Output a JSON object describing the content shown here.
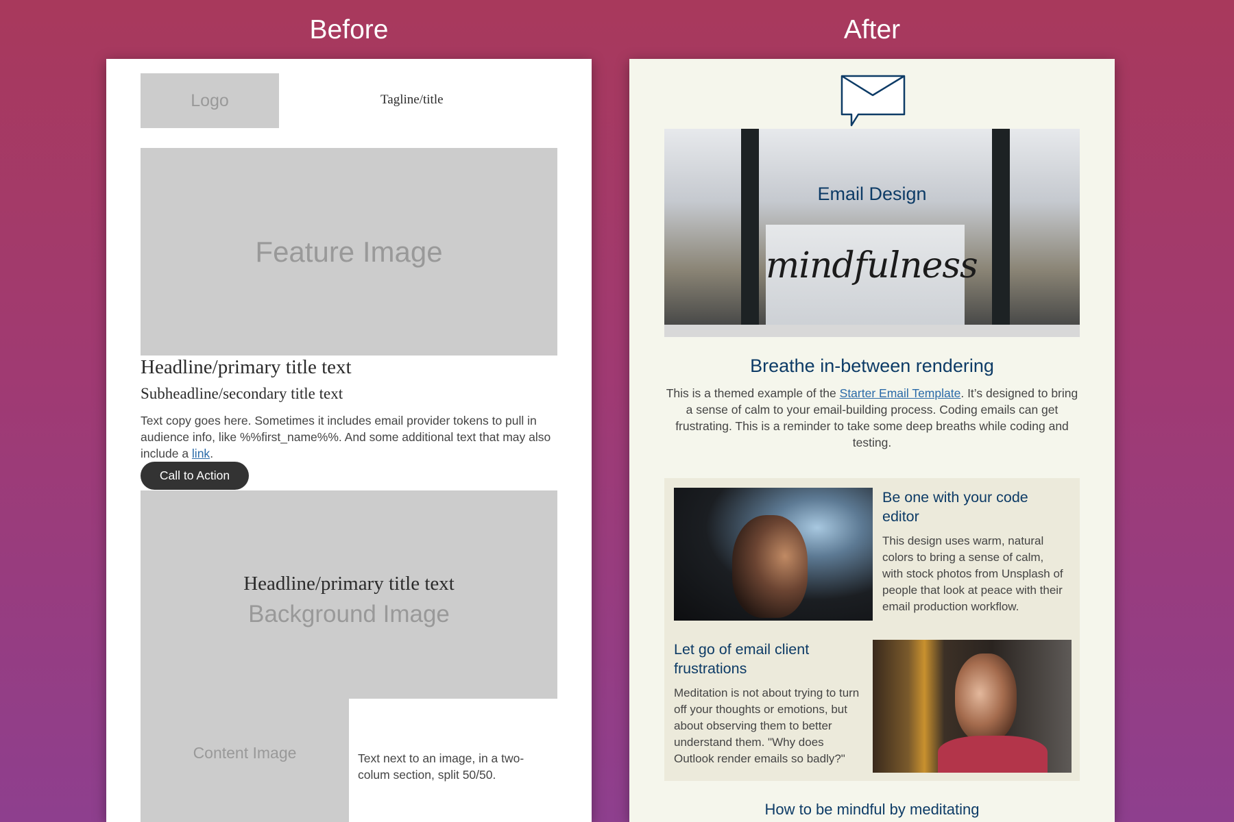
{
  "labels": {
    "before": "Before",
    "after": "After"
  },
  "before": {
    "logo": "Logo",
    "tagline": "Tagline/title",
    "feature_image": "Feature Image",
    "headline": "Headline/primary title text",
    "subheadline": "Subheadline/secondary title text",
    "copy_text": "Text copy goes here. Sometimes it includes email provider tokens to pull in audience info, like %%first_name%%. And some additional text that may also include a ",
    "copy_link": "link",
    "copy_end": ".",
    "cta": "Call to Action",
    "background_image": "Background Image",
    "bg_headline": "Headline/primary title text",
    "content_image": "Content Image",
    "twocol_text": "Text next to an image, in a two-colum section, split 50/50."
  },
  "after": {
    "icon": "envelope-speech-icon",
    "hero_title": "Email Design",
    "hero_script": "mindfulness",
    "title": "Breathe in-between rendering",
    "intro_before": "This is a themed example of the ",
    "intro_link": "Starter Email Template",
    "intro_after": ". It’s designed to bring a sense of calm to your email-building process. Coding emails can get frustrating. This is a reminder to take some deep breaths while coding and testing.",
    "section1": {
      "title": "Be one with your code editor",
      "body": "This design uses warm, natural colors to bring a sense of calm, with stock photos from Unsplash of people that look at peace with their email production workflow."
    },
    "section2": {
      "title": "Let go of email client frustrations",
      "body": "Meditation is not about trying to turn off your thoughts or emotions, but about observing them to better understand them. \"Why does Outlook render emails so badly?\""
    },
    "bottom_title": "How to be mindful by meditating"
  },
  "colors": {
    "background_top": "#a8395c",
    "background_bottom": "#8e3f8e",
    "placeholder": "#cccccc",
    "after_background": "#f5f6ec",
    "after_box": "#eceadb",
    "heading_blue": "#0d3b66",
    "link_blue": "#2a6aa8",
    "cta_dark": "#333333"
  }
}
